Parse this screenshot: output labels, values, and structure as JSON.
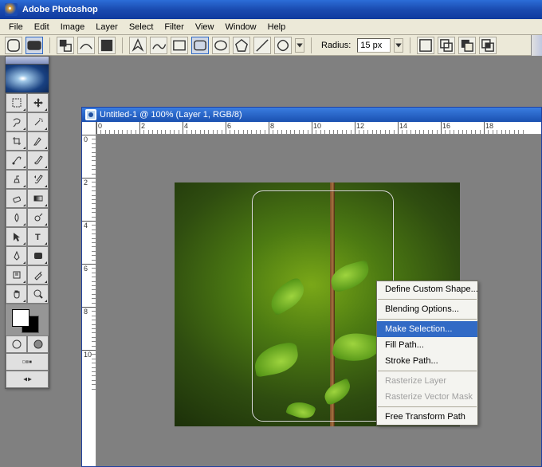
{
  "app": {
    "title": "Adobe Photoshop"
  },
  "menubar": [
    "File",
    "Edit",
    "Image",
    "Layer",
    "Select",
    "Filter",
    "View",
    "Window",
    "Help"
  ],
  "optionbar": {
    "radius_label": "Radius:",
    "radius_value": "15 px"
  },
  "tools": {
    "names": [
      "rectangular-marquee",
      "move",
      "lasso",
      "magic-wand",
      "crop",
      "slice",
      "healing-brush",
      "brush",
      "clone-stamp",
      "history-brush",
      "eraser",
      "gradient",
      "blur",
      "dodge",
      "path-selection",
      "type",
      "pen",
      "rectangle",
      "notes",
      "eyedropper",
      "hand",
      "zoom"
    ],
    "mode_icons": [
      "standard-mode",
      "quick-mask-mode"
    ],
    "screen_icons": [
      "screen-standard",
      "screen-full-menu",
      "screen-full"
    ],
    "swatch": {
      "fg": "#ffffff",
      "bg": "#000000"
    }
  },
  "document": {
    "title": "Untitled-1 @ 100% (Layer 1, RGB/8)"
  },
  "ruler": {
    "h_labels": [
      "0",
      "2",
      "4",
      "6",
      "8",
      "10",
      "12",
      "14",
      "16",
      "18"
    ],
    "v_labels": [
      "0",
      "2",
      "4",
      "6",
      "8",
      "10"
    ]
  },
  "context_menu": {
    "items": [
      {
        "label": "Define Custom Shape...",
        "disabled": false
      },
      {
        "sep": true
      },
      {
        "label": "Blending Options...",
        "disabled": false
      },
      {
        "sep": true
      },
      {
        "label": "Make Selection...",
        "disabled": false,
        "selected": true
      },
      {
        "label": "Fill Path...",
        "disabled": false
      },
      {
        "label": "Stroke Path...",
        "disabled": false
      },
      {
        "sep": true
      },
      {
        "label": "Rasterize Layer",
        "disabled": true
      },
      {
        "label": "Rasterize Vector Mask",
        "disabled": true
      },
      {
        "sep": true
      },
      {
        "label": "Free Transform Path",
        "disabled": false
      }
    ]
  }
}
